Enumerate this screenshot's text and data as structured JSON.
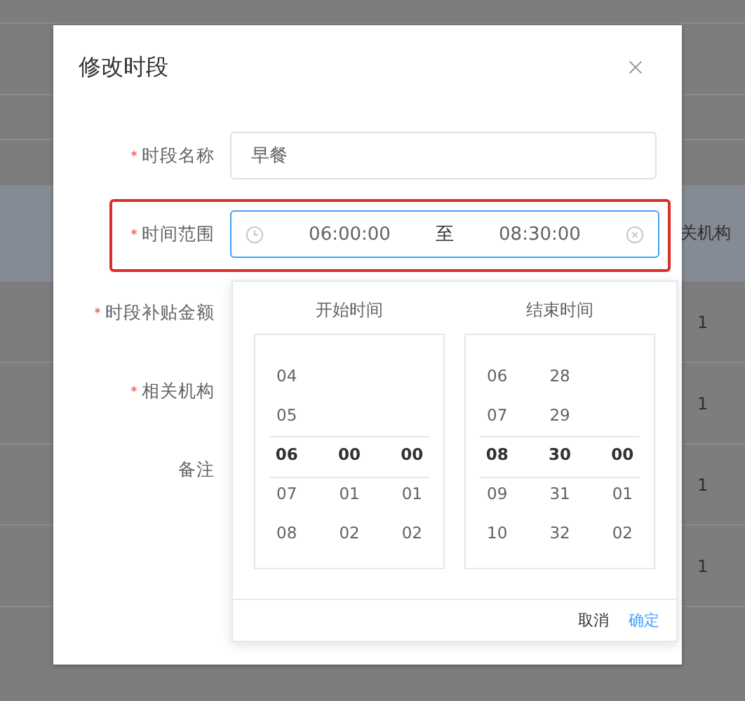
{
  "background_table": {
    "header": "关机构",
    "rows": [
      "1",
      "1",
      "1",
      "1"
    ]
  },
  "dialog": {
    "title": "修改时段",
    "fields": [
      {
        "label": "时段名称",
        "required": true,
        "kind": "text",
        "value": "早餐"
      },
      {
        "label": "时间范围",
        "required": true,
        "kind": "range",
        "start": "06:00:00",
        "separator": "至",
        "end": "08:30:00",
        "highlighted": true
      },
      {
        "label": "时段补贴金额",
        "required": true
      },
      {
        "label": "相关机构",
        "required": true
      },
      {
        "label": "备注",
        "required": false
      }
    ]
  },
  "time_picker": {
    "panels": [
      {
        "title": "开始时间",
        "columns": [
          {
            "above": [
              "04",
              "05"
            ],
            "selected": "06",
            "below": [
              "07",
              "08"
            ]
          },
          {
            "selected": "00",
            "below": [
              "01",
              "02"
            ]
          },
          {
            "selected": "00",
            "below": [
              "01",
              "02"
            ]
          }
        ]
      },
      {
        "title": "结束时间",
        "columns": [
          {
            "above": [
              "06",
              "07"
            ],
            "selected": "08",
            "below": [
              "09",
              "10"
            ]
          },
          {
            "above": [
              "28",
              "29"
            ],
            "selected": "30",
            "below": [
              "31",
              "32"
            ]
          },
          {
            "selected": "00",
            "below": [
              "01",
              "02"
            ]
          }
        ]
      }
    ],
    "buttons": [
      {
        "label": "取消",
        "kind": "plain"
      },
      {
        "label": "确定",
        "kind": "primary"
      }
    ]
  }
}
